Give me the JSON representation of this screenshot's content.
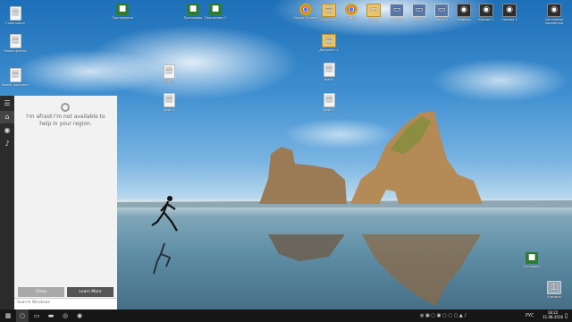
{
  "desktop": {
    "icons": [
      {
        "label": "Скриншоты",
        "glyph": "▤",
        "kind": "doc"
      },
      {
        "label": "Новые файлы",
        "glyph": "▤",
        "kind": "doc"
      },
      {
        "label": "Новый документ",
        "glyph": "▤",
        "kind": "doc"
      },
      {
        "label": "Приложение",
        "glyph": "■",
        "kind": "app"
      },
      {
        "label": "Программа",
        "glyph": "■",
        "kind": "app"
      },
      {
        "label": "Программа 2",
        "glyph": "■",
        "kind": "app"
      },
      {
        "label": "Google Chrome",
        "glyph": "",
        "kind": "chrome"
      },
      {
        "label": "Документ",
        "glyph": "▤",
        "kind": "folder"
      },
      {
        "label": "Chrome",
        "glyph": "",
        "kind": "chrome"
      },
      {
        "label": "Папка",
        "glyph": "▭",
        "kind": "folder"
      },
      {
        "label": "Экран 1",
        "glyph": "▭",
        "kind": "screen"
      },
      {
        "label": "Экран 2",
        "glyph": "▭",
        "kind": "screen"
      },
      {
        "label": "Экран 3",
        "glyph": "▭",
        "kind": "screen"
      },
      {
        "label": "Камера",
        "glyph": "◉",
        "kind": "dark"
      },
      {
        "label": "Камера 2",
        "glyph": "◉",
        "kind": "dark"
      },
      {
        "label": "Камера 3",
        "glyph": "◉",
        "kind": "dark"
      },
      {
        "label": "Системные параметры",
        "glyph": "◉",
        "kind": "dark"
      },
      {
        "label": "Документ 2",
        "glyph": "▤",
        "kind": "folder"
      },
      {
        "label": "Файл",
        "glyph": "▤",
        "kind": "doc"
      },
      {
        "label": "Файл 2",
        "glyph": "▤",
        "kind": "doc"
      },
      {
        "label": "Файл 3",
        "glyph": "▤",
        "kind": "doc"
      },
      {
        "label": "Файл 4",
        "glyph": "▤",
        "kind": "doc"
      },
      {
        "label": "Установка",
        "glyph": "■",
        "kind": "app"
      },
      {
        "label": "Корзина",
        "glyph": "▥",
        "kind": "bin"
      }
    ]
  },
  "cortana": {
    "message": "I'm afraid I'm not available to help in your region.",
    "close_label": "Close",
    "learn_more_label": "Learn More",
    "search_placeholder": "Search Windows"
  },
  "taskbar": {
    "language": "РУС",
    "time": "18:22",
    "date": "11.08.2016"
  }
}
